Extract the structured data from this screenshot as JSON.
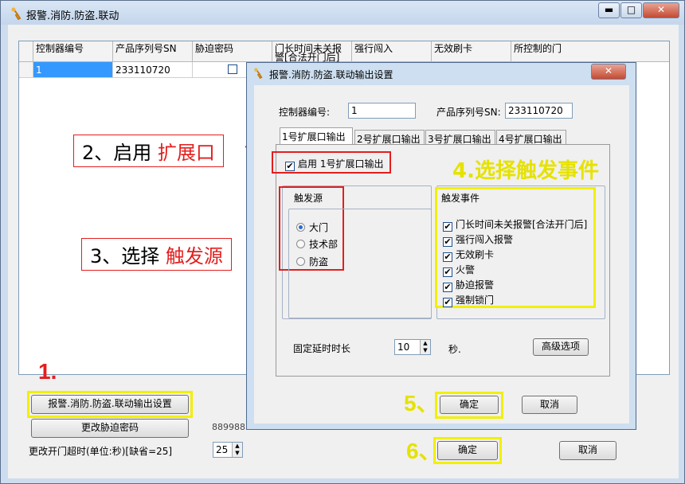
{
  "window": {
    "title": "报警.消防.防盗.联动",
    "minimize": "▬",
    "maximize": "□",
    "close": "✕"
  },
  "grid": {
    "headers": [
      "控制器编号",
      "产品序列号SN",
      "胁迫密码",
      "门长时间未关报警[合法开门后]",
      "强行闯入",
      "无效刷卡",
      "所控制的门"
    ],
    "row": {
      "controller": "1",
      "serial": "233110720"
    }
  },
  "bottom": {
    "step1": "1.",
    "settings_button": "报警.消防.防盗.联动输出设置",
    "change_pw_button": "更改胁迫密码",
    "pw_value": "889988",
    "timeout_label": "更改开门超时(单位:秒)[缺省=25]",
    "timeout_value": "25",
    "step6": "6、",
    "ok_button": "确定",
    "cancel_button": "取消"
  },
  "callouts": {
    "step2_prefix": "2、启用 ",
    "step2_highlight": "扩展口",
    "step3_prefix": "3、选择 ",
    "step3_highlight": "触发源",
    "step4": "4.选择触发事件",
    "step5": "5、"
  },
  "dialog": {
    "title": "报警.消防.防盗.联动输出设置",
    "close": "✕",
    "controller_label": "控制器编号:",
    "controller_value": "1",
    "serial_label": "产品序列号SN:",
    "serial_value": "233110720",
    "tabs": [
      "1号扩展口输出",
      "2号扩展口输出",
      "3号扩展口输出",
      "4号扩展口输出"
    ],
    "enable_label": "启用 1号扩展口输出",
    "source_group": "触发源",
    "sources": [
      "大门",
      "技术部",
      "防盗"
    ],
    "event_group": "触发事件",
    "events": [
      "门长时间未关报警[合法开门后]",
      "强行闯入报警",
      "无效刷卡",
      "火警",
      "胁迫报警",
      "强制锁门"
    ],
    "delay_label": "固定延时时长",
    "delay_value": "10",
    "delay_unit": "秒.",
    "advanced_button": "高级选项",
    "ok_button": "确定",
    "cancel_button": "取消"
  },
  "colors": {
    "highlight_red": "#e41e1e",
    "highlight_yellow": "#f2ef00"
  }
}
